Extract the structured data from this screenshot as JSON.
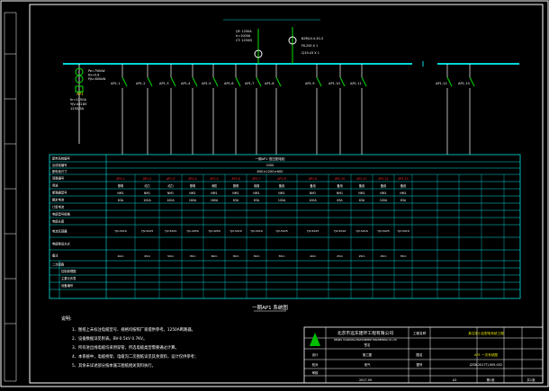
{
  "colors": {
    "background": "#000000",
    "frame": "#ffffff",
    "table_lines": "#00e0e0",
    "busbar": "#00d8d8",
    "switch": "#00e000",
    "circuit_id": "#ffffff",
    "breaker_red": "#ff3030",
    "label_yellow": "#e8e800",
    "notes": "#ffffff",
    "logo": "#00c000"
  },
  "title_block": {
    "company": "北京市远东建环工程有限公司",
    "company_en": "BEIJING YUANDONG ENVIRONMENT ENGINEERING CO.,LTD",
    "project_label": "工程名称",
    "project_name": "某住宅小区配电系统工程",
    "drawing_label": "图名",
    "drawing_name": "AP1 一次系统图",
    "sheet_label": "图号",
    "drawing_no": "JZSB-2017TJ-009-002",
    "date": "2017.09",
    "scale_label": "比例",
    "scale": "A3",
    "sheet": "第1张",
    "sheet_total": "共1张",
    "design": "设计",
    "check": "校对",
    "approve": "审核",
    "stage": "施工图",
    "specialty": "电气",
    "signature_label": "签名"
  },
  "diagram_caption": "一期AP1 系统图",
  "notes": {
    "heading": "说明:",
    "lines": [
      "1、图纸上未标注电缆型号、规格均按照厂家提供参考。1250A断路器。",
      "2、设备数据详见附表。BV-0.5kV 0.7KV。",
      "3、所有进出线电缆均采用穿管，所选电缆类型需要通过计算。",
      "4、本系统中，电缆桥架、电缆沟二次图纸详见其余资料，设计仅供参考；",
      "5、其余未详述部分按本施工图纸相关资料执行。"
    ]
  },
  "incoming": {
    "panel_id": "AP1",
    "lines": [
      "In=1250A",
      "YJV-4X185",
      "1250/5A"
    ],
    "meter_lines": [
      "Pe=750kW",
      "Kx=0.8",
      "Pjs=600kW"
    ],
    "transformer_lines": [
      "QF: 1250A",
      "Ir=1000A",
      "CT: 1250/5"
    ]
  },
  "cap_bank": {
    "labels": [
      "BZMJ-0.4-30-3",
      "FK-200 X 1",
      "CJ19-43 X 1"
    ]
  },
  "feeders": [
    {
      "id": "AP1-1",
      "breaker": "NM1",
      "current": "63A",
      "spec": "YJV-5X16",
      "length": "40m",
      "use": "照明"
    },
    {
      "id": "AP1-2",
      "breaker": "NM1",
      "current": "100A",
      "spec": "YJV-5X25",
      "length": "45m",
      "use": "动力"
    },
    {
      "id": "AP1-3",
      "breaker": "NM1",
      "current": "100A",
      "spec": "YJV-5X25",
      "length": "50m",
      "use": "动力"
    },
    {
      "id": "AP1-4",
      "breaker": "NM1",
      "current": "160A",
      "spec": "YJV-4X50",
      "length": "35m",
      "use": "照明"
    },
    {
      "id": "AP1-5",
      "breaker": "NM1",
      "current": "160A",
      "spec": "YJV-4X50",
      "length": "60m",
      "use": "消防"
    },
    {
      "id": "AP1-6",
      "breaker": "NM1",
      "current": "63A",
      "spec": "YJV-5X16",
      "length": "30m",
      "use": "照明"
    },
    {
      "id": "AP1-7",
      "breaker": "NM1",
      "current": "63A",
      "spec": "YJV-5X16",
      "length": "30m",
      "use": "电梯"
    },
    {
      "id": "AP1-8",
      "breaker": "NM1",
      "current": "100A",
      "spec": "YJV-5X25",
      "length": "55m",
      "use": "备用"
    },
    {
      "id": "AP1-9",
      "breaker": "NM1",
      "current": "100A",
      "spec": "YJV-5X25",
      "length": "40m",
      "use": "备用"
    },
    {
      "id": "AP1-10",
      "breaker": "NM1",
      "current": "63A",
      "spec": "YJV-5X16",
      "length": "25m",
      "use": "备用"
    },
    {
      "id": "AP1-11",
      "breaker": "NM1",
      "current": "63A",
      "spec": "YJV-5X16",
      "length": "25m",
      "use": "备用"
    },
    {
      "id": "AP1-12",
      "breaker": "NM1",
      "current": "100A",
      "spec": "YJV-5X25",
      "length": "45m",
      "use": "备用"
    },
    {
      "id": "AP1-13",
      "breaker": "NM1",
      "current": "63A",
      "spec": "YJV-5X16",
      "length": "35m",
      "use": "备用"
    }
  ],
  "table": {
    "row_labels": [
      "配电系统编号",
      "出线柜编号",
      "配电柜尺寸",
      "回路编号",
      "用途",
      "断路器型号",
      "额定电流",
      "计算电流",
      "电缆型号规格",
      "电缆长度",
      "电流互感器",
      "电缆敷设方式",
      "备注",
      "二次回路"
    ],
    "merged_top": "一期AP1 低压配电柜",
    "merged_second": "GGD",
    "merged_third": "800×2200×600",
    "sub_rows": [
      "控制原理图",
      "主要元件表",
      "设备编号"
    ]
  }
}
